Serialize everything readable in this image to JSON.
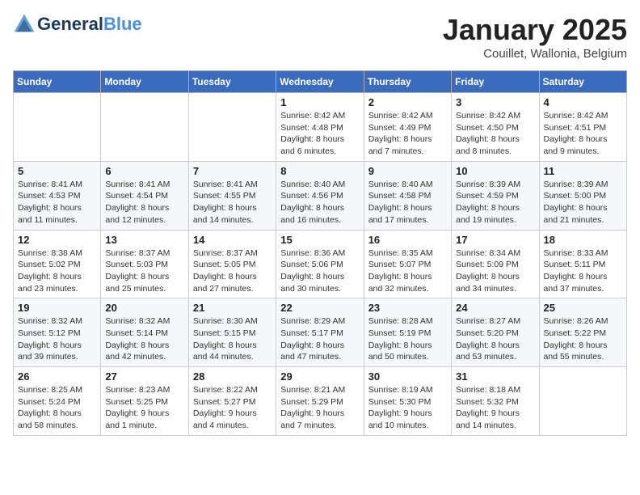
{
  "header": {
    "logo_line1": "General",
    "logo_line2": "Blue",
    "month_title": "January 2025",
    "subtitle": "Couillet, Wallonia, Belgium"
  },
  "weekdays": [
    "Sunday",
    "Monday",
    "Tuesday",
    "Wednesday",
    "Thursday",
    "Friday",
    "Saturday"
  ],
  "weeks": [
    [
      {
        "day": "",
        "info": ""
      },
      {
        "day": "",
        "info": ""
      },
      {
        "day": "",
        "info": ""
      },
      {
        "day": "1",
        "info": "Sunrise: 8:42 AM\nSunset: 4:48 PM\nDaylight: 8 hours\nand 6 minutes."
      },
      {
        "day": "2",
        "info": "Sunrise: 8:42 AM\nSunset: 4:49 PM\nDaylight: 8 hours\nand 7 minutes."
      },
      {
        "day": "3",
        "info": "Sunrise: 8:42 AM\nSunset: 4:50 PM\nDaylight: 8 hours\nand 8 minutes."
      },
      {
        "day": "4",
        "info": "Sunrise: 8:42 AM\nSunset: 4:51 PM\nDaylight: 8 hours\nand 9 minutes."
      }
    ],
    [
      {
        "day": "5",
        "info": "Sunrise: 8:41 AM\nSunset: 4:53 PM\nDaylight: 8 hours\nand 11 minutes."
      },
      {
        "day": "6",
        "info": "Sunrise: 8:41 AM\nSunset: 4:54 PM\nDaylight: 8 hours\nand 12 minutes."
      },
      {
        "day": "7",
        "info": "Sunrise: 8:41 AM\nSunset: 4:55 PM\nDaylight: 8 hours\nand 14 minutes."
      },
      {
        "day": "8",
        "info": "Sunrise: 8:40 AM\nSunset: 4:56 PM\nDaylight: 8 hours\nand 16 minutes."
      },
      {
        "day": "9",
        "info": "Sunrise: 8:40 AM\nSunset: 4:58 PM\nDaylight: 8 hours\nand 17 minutes."
      },
      {
        "day": "10",
        "info": "Sunrise: 8:39 AM\nSunset: 4:59 PM\nDaylight: 8 hours\nand 19 minutes."
      },
      {
        "day": "11",
        "info": "Sunrise: 8:39 AM\nSunset: 5:00 PM\nDaylight: 8 hours\nand 21 minutes."
      }
    ],
    [
      {
        "day": "12",
        "info": "Sunrise: 8:38 AM\nSunset: 5:02 PM\nDaylight: 8 hours\nand 23 minutes."
      },
      {
        "day": "13",
        "info": "Sunrise: 8:37 AM\nSunset: 5:03 PM\nDaylight: 8 hours\nand 25 minutes."
      },
      {
        "day": "14",
        "info": "Sunrise: 8:37 AM\nSunset: 5:05 PM\nDaylight: 8 hours\nand 27 minutes."
      },
      {
        "day": "15",
        "info": "Sunrise: 8:36 AM\nSunset: 5:06 PM\nDaylight: 8 hours\nand 30 minutes."
      },
      {
        "day": "16",
        "info": "Sunrise: 8:35 AM\nSunset: 5:07 PM\nDaylight: 8 hours\nand 32 minutes."
      },
      {
        "day": "17",
        "info": "Sunrise: 8:34 AM\nSunset: 5:09 PM\nDaylight: 8 hours\nand 34 minutes."
      },
      {
        "day": "18",
        "info": "Sunrise: 8:33 AM\nSunset: 5:11 PM\nDaylight: 8 hours\nand 37 minutes."
      }
    ],
    [
      {
        "day": "19",
        "info": "Sunrise: 8:32 AM\nSunset: 5:12 PM\nDaylight: 8 hours\nand 39 minutes."
      },
      {
        "day": "20",
        "info": "Sunrise: 8:32 AM\nSunset: 5:14 PM\nDaylight: 8 hours\nand 42 minutes."
      },
      {
        "day": "21",
        "info": "Sunrise: 8:30 AM\nSunset: 5:15 PM\nDaylight: 8 hours\nand 44 minutes."
      },
      {
        "day": "22",
        "info": "Sunrise: 8:29 AM\nSunset: 5:17 PM\nDaylight: 8 hours\nand 47 minutes."
      },
      {
        "day": "23",
        "info": "Sunrise: 8:28 AM\nSunset: 5:19 PM\nDaylight: 8 hours\nand 50 minutes."
      },
      {
        "day": "24",
        "info": "Sunrise: 8:27 AM\nSunset: 5:20 PM\nDaylight: 8 hours\nand 53 minutes."
      },
      {
        "day": "25",
        "info": "Sunrise: 8:26 AM\nSunset: 5:22 PM\nDaylight: 8 hours\nand 55 minutes."
      }
    ],
    [
      {
        "day": "26",
        "info": "Sunrise: 8:25 AM\nSunset: 5:24 PM\nDaylight: 8 hours\nand 58 minutes."
      },
      {
        "day": "27",
        "info": "Sunrise: 8:23 AM\nSunset: 5:25 PM\nDaylight: 9 hours\nand 1 minute."
      },
      {
        "day": "28",
        "info": "Sunrise: 8:22 AM\nSunset: 5:27 PM\nDaylight: 9 hours\nand 4 minutes."
      },
      {
        "day": "29",
        "info": "Sunrise: 8:21 AM\nSunset: 5:29 PM\nDaylight: 9 hours\nand 7 minutes."
      },
      {
        "day": "30",
        "info": "Sunrise: 8:19 AM\nSunset: 5:30 PM\nDaylight: 9 hours\nand 10 minutes."
      },
      {
        "day": "31",
        "info": "Sunrise: 8:18 AM\nSunset: 5:32 PM\nDaylight: 9 hours\nand 14 minutes."
      },
      {
        "day": "",
        "info": ""
      }
    ]
  ]
}
